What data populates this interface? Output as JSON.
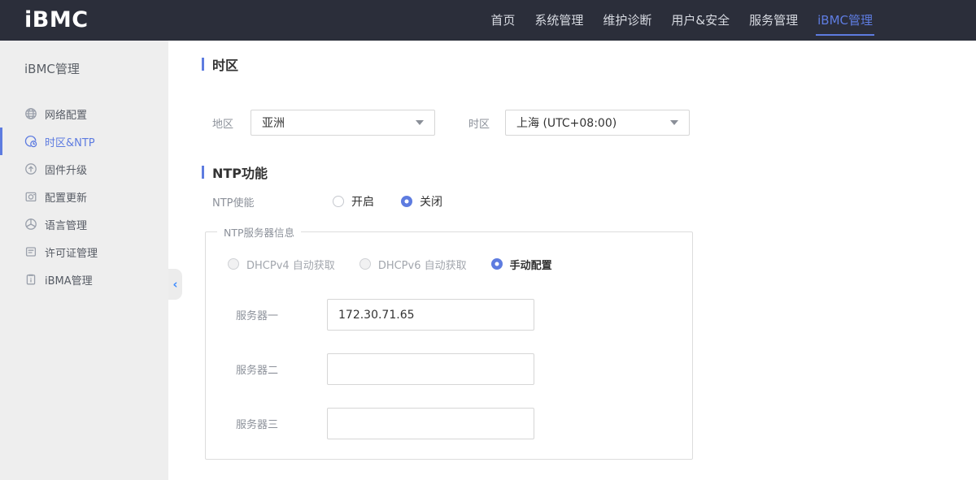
{
  "colors": {
    "accent": "#5e7ce0",
    "topnav_bg": "#2b2e3a",
    "sidebar_bg": "#eeeeee",
    "label_gray": "#8c919a"
  },
  "topnav": {
    "logo": "iBMC",
    "items": [
      {
        "label": "首页",
        "active": false
      },
      {
        "label": "系统管理",
        "active": false
      },
      {
        "label": "维护诊断",
        "active": false
      },
      {
        "label": "用户&安全",
        "active": false
      },
      {
        "label": "服务管理",
        "active": false
      },
      {
        "label": "iBMC管理",
        "active": true
      }
    ]
  },
  "sidebar": {
    "title": "iBMC管理",
    "items": [
      {
        "label": "网络配置",
        "icon": "network-globe-icon",
        "active": false
      },
      {
        "label": "时区&NTP",
        "icon": "timezone-clock-icon",
        "active": true
      },
      {
        "label": "固件升级",
        "icon": "firmware-upgrade-icon",
        "active": false
      },
      {
        "label": "配置更新",
        "icon": "config-update-icon",
        "active": false
      },
      {
        "label": "语言管理",
        "icon": "language-icon",
        "active": false
      },
      {
        "label": "许可证管理",
        "icon": "license-icon",
        "active": false
      },
      {
        "label": "iBMA管理",
        "icon": "ibma-clipboard-icon",
        "active": false
      }
    ],
    "collapse_icon": "‹"
  },
  "main": {
    "timezone_section": {
      "title": "时区",
      "region_label": "地区",
      "region_value": "亚洲",
      "timezone_label": "时区",
      "timezone_value": "上海 (UTC+08:00)"
    },
    "ntp_section": {
      "title": "NTP功能",
      "enable_label": "NTP使能",
      "enable_options": [
        {
          "label": "开启",
          "selected": false
        },
        {
          "label": "关闭",
          "selected": true
        }
      ],
      "server_group": {
        "legend": "NTP服务器信息",
        "mode_options": [
          {
            "label": "DHCPv4 自动获取",
            "selected": false,
            "disabled": true
          },
          {
            "label": "DHCPv6 自动获取",
            "selected": false,
            "disabled": true
          },
          {
            "label": "手动配置",
            "selected": true,
            "disabled": false
          }
        ],
        "servers": [
          {
            "label": "服务器一",
            "value": "172.30.71.65"
          },
          {
            "label": "服务器二",
            "value": ""
          },
          {
            "label": "服务器三",
            "value": ""
          }
        ]
      }
    }
  }
}
